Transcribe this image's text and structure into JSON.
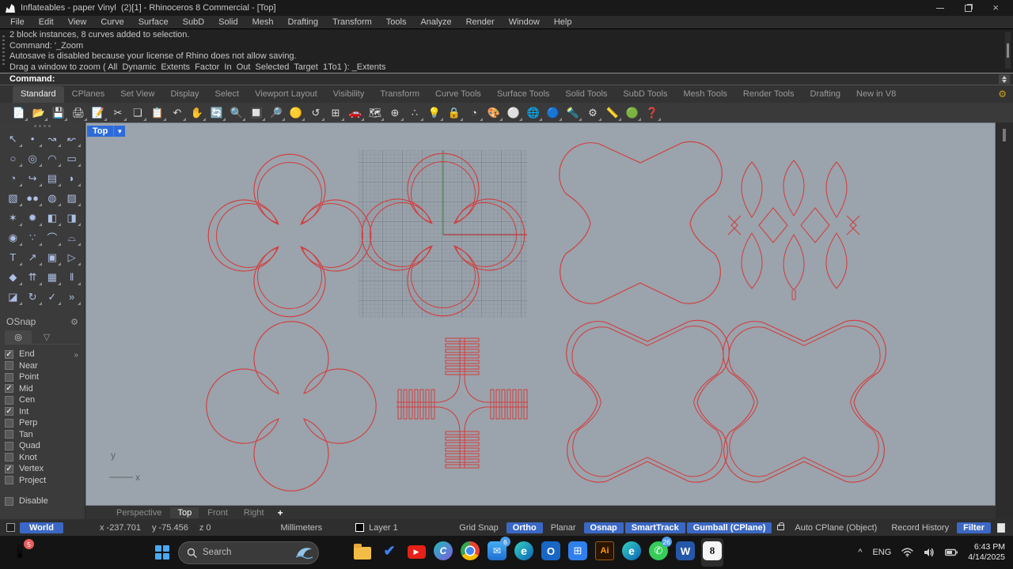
{
  "window": {
    "title": "Inflateables - paper Vinyl  (2)[1] - Rhinoceros 8 Commercial - [Top]"
  },
  "menu": {
    "items": [
      "File",
      "Edit",
      "View",
      "Curve",
      "Surface",
      "SubD",
      "Solid",
      "Mesh",
      "Drafting",
      "Transform",
      "Tools",
      "Analyze",
      "Render",
      "Window",
      "Help"
    ]
  },
  "command": {
    "history": [
      "2 block instances, 8 curves added to selection.",
      "Command: '_Zoom",
      "Autosave is disabled because your license of Rhino does not allow saving.",
      "Drag a window to zoom ( All  Dynamic  Extents  Factor  In  Out  Selected  Target  1To1 ): _Extents"
    ],
    "prompt": "Command:"
  },
  "toolbar_tabs": {
    "items": [
      {
        "label": "Standard",
        "active": true
      },
      {
        "label": "CPlanes"
      },
      {
        "label": "Set View"
      },
      {
        "label": "Display"
      },
      {
        "label": "Select"
      },
      {
        "label": "Viewport Layout"
      },
      {
        "label": "Visibility"
      },
      {
        "label": "Transform"
      },
      {
        "label": "Curve Tools"
      },
      {
        "label": "Surface Tools"
      },
      {
        "label": "Solid Tools"
      },
      {
        "label": "SubD Tools"
      },
      {
        "label": "Mesh Tools"
      },
      {
        "label": "Render Tools"
      },
      {
        "label": "Drafting"
      },
      {
        "label": "New in V8"
      }
    ],
    "gear": "⚙"
  },
  "toolbar": {
    "icons": [
      {
        "name": "new-file-icon",
        "glyph": "📄"
      },
      {
        "name": "open-file-icon",
        "glyph": "📂"
      },
      {
        "name": "save-icon",
        "glyph": "💾"
      },
      {
        "name": "print-icon",
        "glyph": "🖨"
      },
      {
        "name": "edit-notes-icon",
        "glyph": "📝"
      },
      {
        "name": "cut-icon",
        "glyph": "✂"
      },
      {
        "name": "copy-icon",
        "glyph": "❏"
      },
      {
        "name": "paste-icon",
        "glyph": "📋"
      },
      {
        "name": "undo-icon",
        "glyph": "↶"
      },
      {
        "name": "pan-view-icon",
        "glyph": "✋"
      },
      {
        "name": "rotate-view-icon",
        "glyph": "🔄"
      },
      {
        "name": "zoom-dynamic-icon",
        "glyph": "🔍"
      },
      {
        "name": "zoom-window-icon",
        "glyph": "🔲"
      },
      {
        "name": "zoom-extents-icon",
        "glyph": "🔎"
      },
      {
        "name": "zoom-selected-icon",
        "glyph": "🟡"
      },
      {
        "name": "undo-view-icon",
        "glyph": "↺"
      },
      {
        "name": "viewport-layout-icon",
        "glyph": "⊞"
      },
      {
        "name": "named-view-car-icon",
        "glyph": "🚗"
      },
      {
        "name": "texture-map-icon",
        "glyph": "🗺"
      },
      {
        "name": "cplane-icon",
        "glyph": "⊕"
      },
      {
        "name": "snap-points-icon",
        "glyph": "∴"
      },
      {
        "name": "lights-icon",
        "glyph": "💡"
      },
      {
        "name": "lock-icon",
        "glyph": "🔒"
      },
      {
        "name": "display-pie-icon",
        "glyph": "◔"
      },
      {
        "name": "color-wheel-icon",
        "glyph": "🎨"
      },
      {
        "name": "shaded-sphere-icon",
        "glyph": "⚪"
      },
      {
        "name": "wire-sphere-icon",
        "glyph": "🌐"
      },
      {
        "name": "render-sphere-icon",
        "glyph": "🔵"
      },
      {
        "name": "spotlight-icon",
        "glyph": "🔦"
      },
      {
        "name": "gears-icon",
        "glyph": "⚙"
      },
      {
        "name": "dimension-icon",
        "glyph": "📏"
      },
      {
        "name": "render-globe-icon",
        "glyph": "🟢"
      },
      {
        "name": "help-icon",
        "glyph": "❓"
      }
    ]
  },
  "sidebar": {
    "tools": [
      {
        "name": "select-arrow-icon",
        "glyph": "↖"
      },
      {
        "name": "point-icon",
        "glyph": "•"
      },
      {
        "name": "curve-interp-icon",
        "glyph": "↝"
      },
      {
        "name": "curve-freeform-icon",
        "glyph": "↜"
      },
      {
        "name": "circle-icon",
        "glyph": "○"
      },
      {
        "name": "ellipse-icon",
        "glyph": "◎"
      },
      {
        "name": "arc-icon",
        "glyph": "◠"
      },
      {
        "name": "rectangle-icon",
        "glyph": "▭"
      },
      {
        "name": "circle-tan-icon",
        "glyph": "◔"
      },
      {
        "name": "fillet-curve-icon",
        "glyph": "↪"
      },
      {
        "name": "srf-points-icon",
        "glyph": "▤"
      },
      {
        "name": "srf-curved-icon",
        "glyph": "◗"
      },
      {
        "name": "box-icon",
        "glyph": "▧"
      },
      {
        "name": "spheres-icon",
        "glyph": "●●"
      },
      {
        "name": "torus-icon",
        "glyph": "◍"
      },
      {
        "name": "patch-icon",
        "glyph": "▨"
      },
      {
        "name": "explode-icon",
        "glyph": "✶"
      },
      {
        "name": "explode-all-icon",
        "glyph": "✹"
      },
      {
        "name": "trim-icon",
        "glyph": "◧"
      },
      {
        "name": "split-icon",
        "glyph": "◨"
      },
      {
        "name": "boolean-union-icon",
        "glyph": "◉"
      },
      {
        "name": "boolean-diff-icon",
        "glyph": "∵"
      },
      {
        "name": "arc-blend-icon",
        "glyph": "⌒"
      },
      {
        "name": "curve-blend-icon",
        "glyph": "⌓"
      },
      {
        "name": "text-icon",
        "glyph": "T"
      },
      {
        "name": "scale-icon",
        "glyph": "↗"
      },
      {
        "name": "array-icon",
        "glyph": "▣"
      },
      {
        "name": "mirror-icon",
        "glyph": "▷"
      },
      {
        "name": "extrude-icon",
        "glyph": "◆"
      },
      {
        "name": "array-linear-icon",
        "glyph": "⇈"
      },
      {
        "name": "array-grid-icon",
        "glyph": "▦"
      },
      {
        "name": "section-icon",
        "glyph": "‖"
      },
      {
        "name": "bend-icon",
        "glyph": "◪"
      },
      {
        "name": "twist-icon",
        "glyph": "↻"
      },
      {
        "name": "check-icon",
        "glyph": "✓"
      },
      {
        "name": "more-tools-icon",
        "glyph": "»"
      }
    ]
  },
  "osnap": {
    "title": "OSnap",
    "gear": "⚙",
    "overflow": "»",
    "tab_snap": "◎",
    "tab_filter": "▽",
    "items": [
      {
        "label": "End",
        "checked": true
      },
      {
        "label": "Near"
      },
      {
        "label": "Point"
      },
      {
        "label": "Mid",
        "checked": true
      },
      {
        "label": "Cen"
      },
      {
        "label": "Int",
        "checked": true
      },
      {
        "label": "Perp"
      },
      {
        "label": "Tan"
      },
      {
        "label": "Quad"
      },
      {
        "label": "Knot"
      },
      {
        "label": "Vertex",
        "checked": true
      },
      {
        "label": "Project"
      }
    ],
    "disable": {
      "label": "Disable"
    }
  },
  "viewport": {
    "label": "Top",
    "axis_x": "x",
    "axis_y": "y"
  },
  "viewport_tabs": {
    "items": [
      {
        "label": "Perspective"
      },
      {
        "label": "Top",
        "active": true
      },
      {
        "label": "Front"
      },
      {
        "label": "Right"
      },
      {
        "label": "+",
        "plus": true
      }
    ]
  },
  "statusbar": {
    "cplane": "World",
    "coords": [
      "x -237.701",
      "y -75.456",
      "z 0"
    ],
    "units": "Millimeters",
    "layer": "Layer 1",
    "toggles": [
      {
        "label": "Grid Snap"
      },
      {
        "label": "Ortho",
        "on": true
      },
      {
        "label": "Planar"
      },
      {
        "label": "Osnap",
        "on": true
      },
      {
        "label": "SmartTrack",
        "on": true
      },
      {
        "label": "Gumball (CPlane)",
        "on": true
      },
      {
        "label": "Auto CPlane (Object)",
        "lock": true
      },
      {
        "label": "Record History"
      },
      {
        "label": "Filter",
        "on": true
      }
    ]
  },
  "taskbar": {
    "weather": {
      "glyph": "🌡",
      "badge": "5"
    },
    "search": {
      "placeholder": "Search"
    },
    "apps": [
      {
        "name": "task-view",
        "glyph": "",
        "cls": "taskview"
      },
      {
        "name": "file-explorer",
        "glyph": "",
        "cls": "folder"
      },
      {
        "name": "todo-check",
        "glyph": "✔",
        "cls": "check"
      },
      {
        "name": "youtube",
        "glyph": "▶",
        "cls": "yt",
        "running": true
      },
      {
        "name": "canva",
        "glyph": "C",
        "cls": "canva",
        "running": true
      },
      {
        "name": "chrome",
        "glyph": "",
        "cls": "chrome"
      },
      {
        "name": "mail",
        "glyph": "✉",
        "cls": "mail",
        "badge": "6",
        "badge_blue": true
      },
      {
        "name": "edge",
        "glyph": "e",
        "cls": "edge"
      },
      {
        "name": "outlook",
        "glyph": "O",
        "cls": "outlook"
      },
      {
        "name": "ms-store",
        "glyph": "⊞",
        "cls": "store"
      },
      {
        "name": "illustrator",
        "glyph": "Ai",
        "cls": "ai"
      },
      {
        "name": "edge-profile",
        "glyph": "e",
        "cls": "edge",
        "running": true
      },
      {
        "name": "whatsapp",
        "glyph": "✆",
        "cls": "wa",
        "badge": "26",
        "badge_blue": true
      },
      {
        "name": "word",
        "glyph": "W",
        "cls": "word",
        "running": true
      },
      {
        "name": "rhino-8",
        "glyph": "8",
        "cls": "rhino",
        "active": true
      }
    ],
    "tray": {
      "chevron": "^",
      "lang": "ENG",
      "time": "6:43 PM",
      "date": "4/14/2025"
    }
  }
}
